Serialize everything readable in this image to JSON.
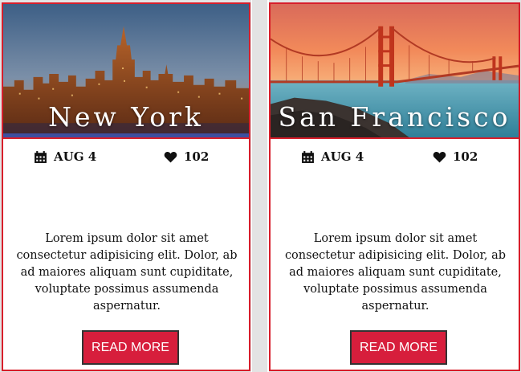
{
  "cards": [
    {
      "city": "New York",
      "date": "AUG 4",
      "likes": "102",
      "description": "Lorem ipsum dolor sit amet consectetur adipisicing elit. Dolor, ab ad maiores aliquam sunt cupiditate, voluptate possimus assumenda aspernatur.",
      "button_label": "READ MORE"
    },
    {
      "city": "San Francisco",
      "date": "AUG 4",
      "likes": "102",
      "description": "Lorem ipsum dolor sit amet consectetur adipisicing elit. Dolor, ab ad maiores aliquam sunt cupiditate, voluptate possimus assumenda aspernatur.",
      "button_label": "READ MORE"
    }
  ],
  "icons": {
    "date": "calendar-icon",
    "likes": "heart-icon"
  },
  "colors": {
    "accent": "#d71e2b",
    "button": "#d71e3c"
  }
}
